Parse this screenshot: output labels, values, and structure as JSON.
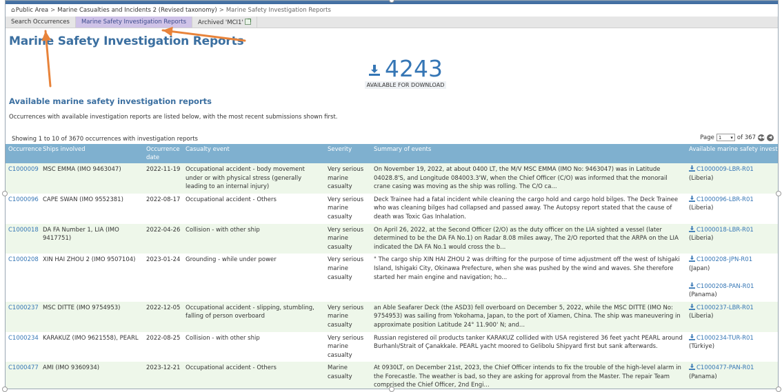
{
  "breadcrumb": {
    "home_icon": "home-icon",
    "items": [
      "Public Area",
      "Marine Casualties and Incidents 2 (Revised taxonomy)",
      "Marine Safety Investigation Reports"
    ]
  },
  "tabs": [
    {
      "label": "Search Occurrences"
    },
    {
      "label": "Marine Safety Investigation Reports"
    },
    {
      "label": "Archived 'MCI1'"
    }
  ],
  "page_title": "Marine Safety Investigation Reports",
  "download": {
    "count": "4243",
    "label": "AVAILABLE FOR DOWNLOAD",
    "icon": "download-icon"
  },
  "section": {
    "title": "Available marine safety investigation reports",
    "description": "Occurrences with available investigation reports are listed below, with the most recent submissions shown first."
  },
  "listing": {
    "showing": "Showing 1 to 10 of 3670 occurrences with investigation reports",
    "page_label": "Page",
    "page_value": "1",
    "page_of": "of 367"
  },
  "table": {
    "headers": {
      "occurrence": "Occurrence",
      "ships": "Ships involved",
      "date": "Occurrence date",
      "casualty": "Casualty event",
      "severity": "Severity",
      "summary": "Summary of events",
      "reports": "Available marine safety investigation reports"
    },
    "rows": [
      {
        "occurrence": "C1000009",
        "ships": "MSC EMMA (IMO 9463047)",
        "date": "2022-11-19",
        "casualty": "Occupational accident - body movement under or with physical stress (generally leading to an internal injury)",
        "severity": "Very serious marine casualty",
        "summary": "On November 19, 2022, at about 0400 LT, the M/V MSC EMMA (IMO No: 9463047) was in Latitude 04028.8'S, and Longitude 084003.3'W, when the Chief Officer (C/O) was informed that the monorail crane casing was moving as the ship was rolling. The C/O ca...",
        "reports": [
          {
            "id": "C1000009-LBR-R01",
            "country": "(Liberia)"
          }
        ]
      },
      {
        "occurrence": "C1000096",
        "ships": "CAPE SWAN (IMO 9552381)",
        "date": "2022-08-17",
        "casualty": "Occupational accident - Others",
        "severity": "Very serious marine casualty",
        "summary": "Deck Trainee had a fatal incident while cleaning the cargo hold and cargo hold bilges. The Deck Trainee who was cleaning bilges had collapsed and passed away. The Autopsy report stated that the cause of death was Toxic Gas Inhalation.",
        "reports": [
          {
            "id": "C1000096-LBR-R01",
            "country": "(Liberia)"
          }
        ]
      },
      {
        "occurrence": "C1000018",
        "ships": "DA FA Number 1, LIA (IMO 9417751)",
        "date": "2022-04-26",
        "casualty": "Collision - with other ship",
        "severity": "Very serious marine casualty",
        "summary": "On April 26, 2022, at the Second Officer (2/O) as the duty officer on the LIA sighted a vessel (later determined to be the DA FA No.1) on Radar 8.08 miles away, The 2/O reported that the ARPA on the LIA indicated the DA FA No.1 would cross the b...",
        "reports": [
          {
            "id": "C1000018-LBR-R01",
            "country": "(Liberia)"
          }
        ]
      },
      {
        "occurrence": "C1000208",
        "ships": "XIN HAI ZHOU 2 (IMO 9507104)",
        "date": "2023-01-24",
        "casualty": "Grounding - while under power",
        "severity": "Very serious marine casualty",
        "summary": "\"    The cargo ship XIN HAI ZHOU 2 was drifting for the purpose of time adjustment off the west of Ishigaki Island, Ishigaki City, Okinawa Prefecture, when she was pushed by the wind and waves. She therefore started her main engine and navigation; ho...",
        "reports": [
          {
            "id": "C1000208-JPN-R01",
            "country": "(Japan)"
          },
          {
            "id": "C1000208-PAN-R01",
            "country": "(Panama)"
          }
        ]
      },
      {
        "occurrence": "C1000237",
        "ships": "MSC DITTE (IMO 9754953)",
        "date": "2022-12-05",
        "casualty": "Occupational accident - slipping, stumbling, falling of person overboard",
        "severity": "Very serious marine casualty",
        "summary": "an Able Seafarer Deck (the ASD3) fell overboard on December 5, 2022, while the MSC DITTE (IMO No: 9754953) was sailing from Yokohama, Japan, to the port of Xiamen, China. The ship was maneuvering in approximate position Latitude 24° 11.900' N; and...",
        "reports": [
          {
            "id": "C1000237-LBR-R01",
            "country": "(Liberia)"
          }
        ]
      },
      {
        "occurrence": "C1000234",
        "ships": "KARAKUZ (IMO 9621558), PEARL",
        "date": "2022-08-25",
        "casualty": "Collision - with other ship",
        "severity": "Very serious marine casualty",
        "summary": "Russian registered oil products tanker KARAKUZ collided with USA registered 36 feet yacht PEARL around Burhanlı/Strait of Çanakkale. PEARL yacht moored to Gelibolu Shipyard first but sank afterwards.",
        "reports": [
          {
            "id": "C1000234-TUR-R01",
            "country": "(Türkiye)"
          }
        ]
      },
      {
        "occurrence": "C1000477",
        "ships": "AMI (IMO 9360934)",
        "date": "2023-12-21",
        "casualty": "Occupational accident - Others",
        "severity": "Marine casualty",
        "summary": "At 0930LT, on December 21st, 2023, the Chief Officer intends to fix the trouble of the high-level alarm in the Forecastle. The weather is bad, so they are asking for approval from the Master. The repair Team comprised the Chief Officer, 2nd Engi...",
        "reports": [
          {
            "id": "C1000477-PAN-R01",
            "country": "(Panama)"
          }
        ]
      }
    ]
  },
  "annotations": {
    "arrow_color": "#e8833a"
  }
}
